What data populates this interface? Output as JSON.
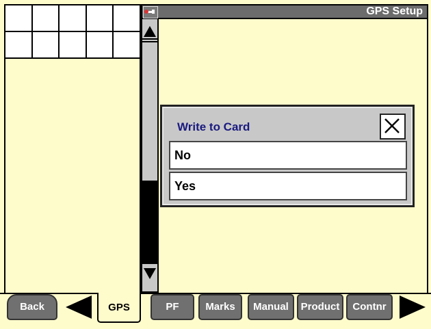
{
  "header": {
    "title": "GPS Setup",
    "icon": "wrench-icon"
  },
  "grid": {
    "rows": 2,
    "cols": 5
  },
  "dialog": {
    "title": "Write to Card",
    "close_icon": "close-icon",
    "options": [
      "No",
      "Yes"
    ]
  },
  "scrollbar": {
    "up_icon": "arrow-up-icon",
    "down_icon": "arrow-down-icon"
  },
  "bottom_bar": {
    "back": "Back",
    "gps": "GPS",
    "pf": "PF",
    "marks": "Marks",
    "manual": "Manual",
    "product": "Product",
    "contnr": "Contnr",
    "prev_icon": "arrow-left-icon",
    "next_icon": "arrow-right-icon"
  }
}
